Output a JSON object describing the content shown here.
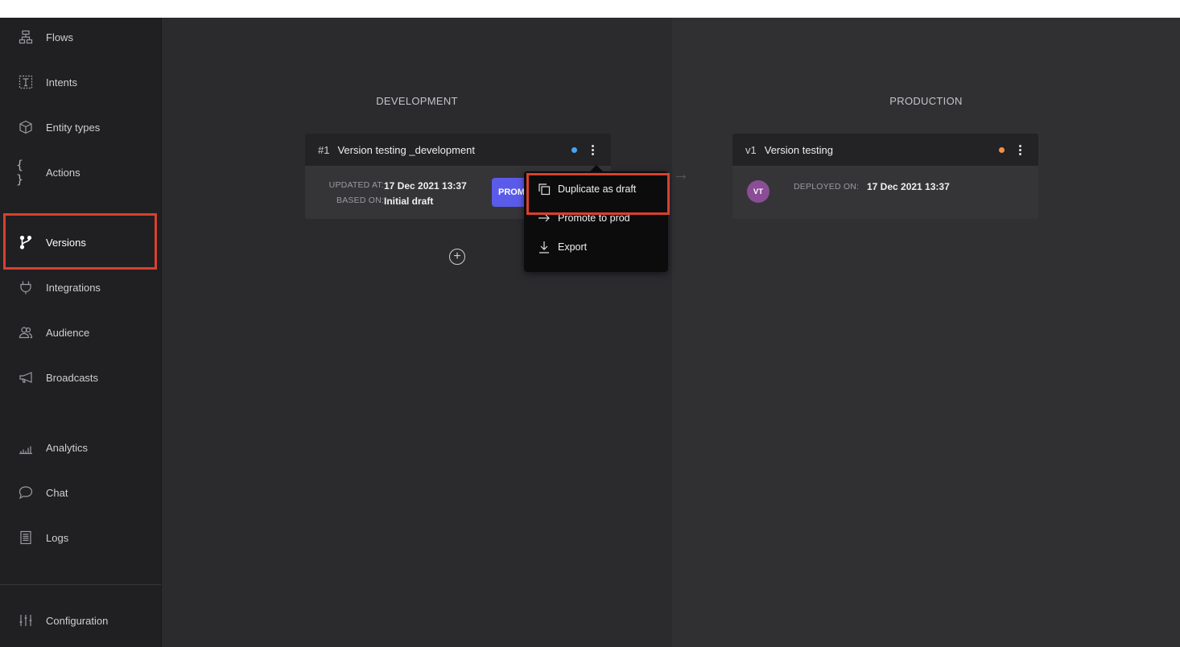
{
  "sidebar": {
    "items": [
      {
        "label": "Flows",
        "icon": "flows-icon"
      },
      {
        "label": "Intents",
        "icon": "intents-icon"
      },
      {
        "label": "Entity types",
        "icon": "cube-icon"
      },
      {
        "label": "Actions",
        "icon": "braces-icon"
      },
      {
        "label": "Versions",
        "icon": "branch-icon"
      },
      {
        "label": "Integrations",
        "icon": "plug-icon"
      },
      {
        "label": "Audience",
        "icon": "users-icon"
      },
      {
        "label": "Broadcasts",
        "icon": "megaphone-icon"
      },
      {
        "label": "Analytics",
        "icon": "bar-chart-icon"
      },
      {
        "label": "Chat",
        "icon": "chat-bubble-icon"
      },
      {
        "label": "Logs",
        "icon": "logs-icon"
      },
      {
        "label": "Configuration",
        "icon": "sliders-icon"
      }
    ],
    "active": "Versions"
  },
  "development": {
    "title": "DEVELOPMENT",
    "card": {
      "tag": "#1",
      "name": "Version testing _development",
      "status_color": "#4aa3f0",
      "updated_label": "UPDATED AT:",
      "updated_value": "17 Dec 2021 13:37",
      "based_label": "BASED ON:",
      "based_value": "Initial draft",
      "promote_label": "PROMOTE"
    }
  },
  "production": {
    "title": "PRODUCTION",
    "card": {
      "tag": "v1",
      "name": "Version testing",
      "status_color": "#f0904a",
      "avatar_initials": "VT",
      "deployed_label": "DEPLOYED ON:",
      "deployed_value": "17 Dec 2021 13:37"
    }
  },
  "menu": {
    "items": [
      {
        "label": "Duplicate as draft",
        "icon": "duplicate-icon"
      },
      {
        "label": "Promote to prod",
        "icon": "arrow-right-icon"
      },
      {
        "label": "Export",
        "icon": "download-icon"
      }
    ]
  },
  "colors": {
    "accent": "#5b5bea",
    "highlight": "#d9402f"
  }
}
